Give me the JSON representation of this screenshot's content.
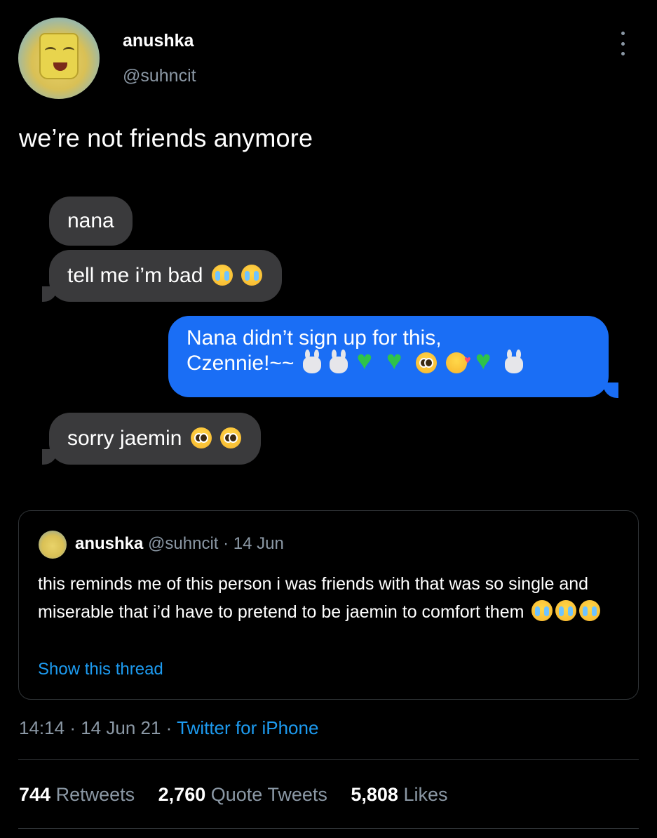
{
  "author": {
    "name": "anushka",
    "handle": "@suhncit"
  },
  "tweet": {
    "text": "we’re not friends anymore"
  },
  "messages": [
    {
      "direction": "incoming",
      "text": "nana",
      "emojis": []
    },
    {
      "direction": "incoming",
      "text": "tell me i’m bad",
      "emojis": [
        "crying-face-icon",
        "crying-face-icon"
      ]
    },
    {
      "direction": "outgoing",
      "line1": "Nana didn’t sign up for this,",
      "line2": "Czennie!~~",
      "emojis": [
        "bunny-icon",
        "bunny-icon",
        "green-heart-icon",
        "green-heart-icon",
        "pleading-face-icon",
        "smiling-face-hearts-icon",
        "green-heart-icon",
        "bunny-icon"
      ]
    },
    {
      "direction": "incoming",
      "text": "sorry jaemin",
      "emojis": [
        "pleading-face-icon",
        "pleading-face-icon"
      ]
    }
  ],
  "quoted": {
    "name": "anushka",
    "handle": "@suhncit",
    "separator": "·",
    "date": "14 Jun",
    "text": "this reminds me of this person i was friends with that was so single and miserable that i’d have to pretend to be jaemin to comfort them",
    "emojis": [
      "crying-face-icon",
      "crying-face-icon",
      "crying-face-icon"
    ],
    "link": "Show this thread"
  },
  "meta": {
    "time": "14:14",
    "separator": "·",
    "date": "14 Jun 21",
    "source": "Twitter for iPhone"
  },
  "stats": {
    "retweets_count": "744",
    "retweets_label": "Retweets",
    "quotes_count": "2,760",
    "quotes_label": "Quote Tweets",
    "likes_count": "5,808",
    "likes_label": "Likes"
  },
  "colors": {
    "background": "#000000",
    "incoming_bubble": "#3a3a3c",
    "outgoing_bubble": "#1a6ef5",
    "secondary_text": "#8b98a5",
    "link": "#1d9bf0"
  }
}
